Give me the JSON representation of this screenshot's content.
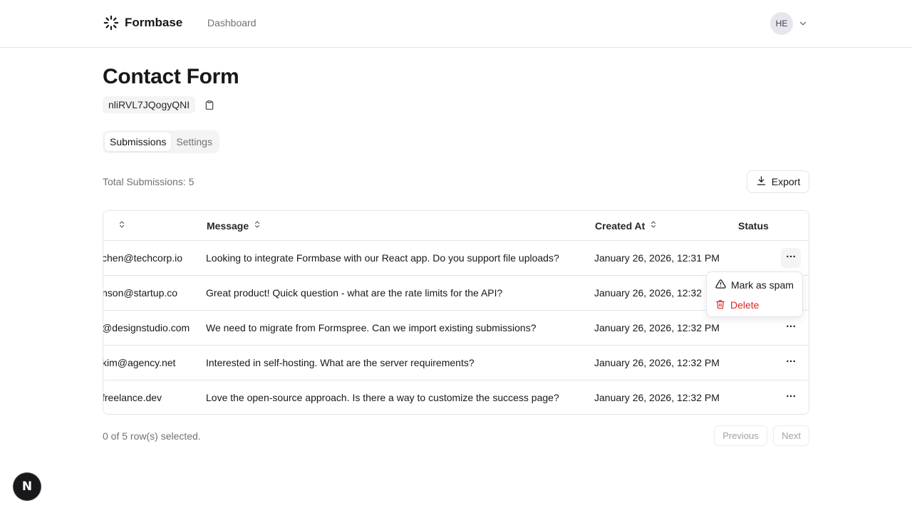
{
  "header": {
    "brand": "Formbase",
    "brand_icon": "spinner-logo-icon",
    "nav": {
      "dashboard": "Dashboard"
    },
    "avatar_initials": "HE"
  },
  "form": {
    "title": "Contact Form",
    "id": "nliRVL7JQogyQNI"
  },
  "tabs": [
    {
      "label": "Submissions",
      "active": true
    },
    {
      "label": "Settings",
      "active": false
    }
  ],
  "summary": {
    "total": "Total Submissions: 5"
  },
  "toolbar": {
    "export_label": "Export"
  },
  "table": {
    "columns": [
      "",
      "Message",
      "Created At",
      "Status"
    ],
    "rows": [
      {
        "email": "chen@techcorp.io",
        "message": "Looking to integrate Formbase with our React app. Do you support file uploads?",
        "created_at": "January 26, 2026, 12:31 PM",
        "status": ""
      },
      {
        "email": "nson@startup.co",
        "message": "Great product! Quick question - what are the rate limits for the API?",
        "created_at": "January 26, 2026, 12:32",
        "status": ""
      },
      {
        "email": "@designstudio.com",
        "message": "We need to migrate from Formspree. Can we import existing submissions?",
        "created_at": "January 26, 2026, 12:32 PM",
        "status": ""
      },
      {
        "email": "kim@agency.net",
        "message": "Interested in self-hosting. What are the server requirements?",
        "created_at": "January 26, 2026, 12:32 PM",
        "status": ""
      },
      {
        "email": "freelance.dev",
        "message": "Love the open-source approach. Is there a way to customize the success page?",
        "created_at": "January 26, 2026, 12:32 PM",
        "status": ""
      }
    ]
  },
  "row_menu": {
    "spam_label": "Mark as spam",
    "delete_label": "Delete",
    "danger_color": "#dc2626"
  },
  "footer": {
    "selected": "0 of 5 row(s) selected.",
    "previous": "Previous",
    "next": "Next"
  },
  "dev_badge": {
    "letter": "N"
  }
}
